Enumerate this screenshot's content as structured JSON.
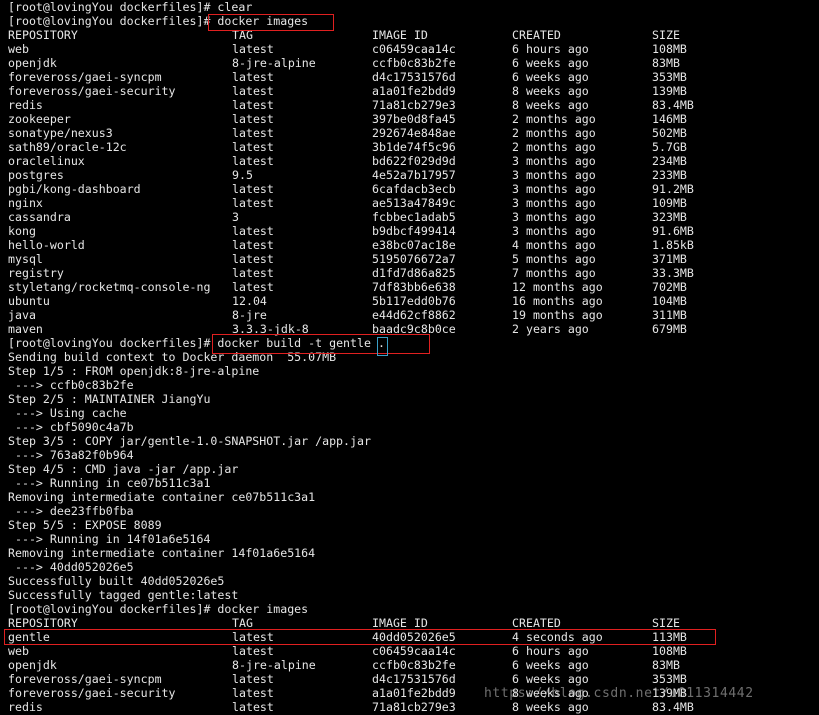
{
  "prompt": "[root@lovingYou dockerfiles]#",
  "commands": {
    "clear": "clear",
    "images1": "docker images",
    "build": "docker build -t gentle .",
    "images2": "docker images"
  },
  "table_header": {
    "repository": "REPOSITORY",
    "tag": "TAG",
    "image_id": "IMAGE ID",
    "created": "CREATED",
    "size": "SIZE"
  },
  "images_before": [
    {
      "repo": "web",
      "tag": "latest",
      "id": "c06459caa14c",
      "created": "6 hours ago",
      "size": "108MB"
    },
    {
      "repo": "openjdk",
      "tag": "8-jre-alpine",
      "id": "ccfb0c83b2fe",
      "created": "6 weeks ago",
      "size": "83MB"
    },
    {
      "repo": "foreveross/gaei-syncpm",
      "tag": "latest",
      "id": "d4c17531576d",
      "created": "6 weeks ago",
      "size": "353MB"
    },
    {
      "repo": "foreveross/gaei-security",
      "tag": "latest",
      "id": "a1a01fe2bdd9",
      "created": "8 weeks ago",
      "size": "139MB"
    },
    {
      "repo": "redis",
      "tag": "latest",
      "id": "71a81cb279e3",
      "created": "8 weeks ago",
      "size": "83.4MB"
    },
    {
      "repo": "zookeeper",
      "tag": "latest",
      "id": "397be0d8fa45",
      "created": "2 months ago",
      "size": "146MB"
    },
    {
      "repo": "sonatype/nexus3",
      "tag": "latest",
      "id": "292674e848ae",
      "created": "2 months ago",
      "size": "502MB"
    },
    {
      "repo": "sath89/oracle-12c",
      "tag": "latest",
      "id": "3b1de74f5c96",
      "created": "2 months ago",
      "size": "5.7GB"
    },
    {
      "repo": "oraclelinux",
      "tag": "latest",
      "id": "bd622f029d9d",
      "created": "3 months ago",
      "size": "234MB"
    },
    {
      "repo": "postgres",
      "tag": "9.5",
      "id": "4e52a7b17957",
      "created": "3 months ago",
      "size": "233MB"
    },
    {
      "repo": "pgbi/kong-dashboard",
      "tag": "latest",
      "id": "6cafdacb3ecb",
      "created": "3 months ago",
      "size": "91.2MB"
    },
    {
      "repo": "nginx",
      "tag": "latest",
      "id": "ae513a47849c",
      "created": "3 months ago",
      "size": "109MB"
    },
    {
      "repo": "cassandra",
      "tag": "3",
      "id": "fcbbec1adab5",
      "created": "3 months ago",
      "size": "323MB"
    },
    {
      "repo": "kong",
      "tag": "latest",
      "id": "b9dbcf499414",
      "created": "3 months ago",
      "size": "91.6MB"
    },
    {
      "repo": "hello-world",
      "tag": "latest",
      "id": "e38bc07ac18e",
      "created": "4 months ago",
      "size": "1.85kB"
    },
    {
      "repo": "mysql",
      "tag": "latest",
      "id": "5195076672a7",
      "created": "5 months ago",
      "size": "371MB"
    },
    {
      "repo": "registry",
      "tag": "latest",
      "id": "d1fd7d86a825",
      "created": "7 months ago",
      "size": "33.3MB"
    },
    {
      "repo": "styletang/rocketmq-console-ng",
      "tag": "latest",
      "id": "7df83bb6e638",
      "created": "12 months ago",
      "size": "702MB"
    },
    {
      "repo": "ubuntu",
      "tag": "12.04",
      "id": "5b117edd0b76",
      "created": "16 months ago",
      "size": "104MB"
    },
    {
      "repo": "java",
      "tag": "8-jre",
      "id": "e44d62cf8862",
      "created": "19 months ago",
      "size": "311MB"
    },
    {
      "repo": "maven",
      "tag": "3.3.3-jdk-8",
      "id": "baadc9c8b0ce",
      "created": "2 years ago",
      "size": "679MB"
    }
  ],
  "build_output": [
    "Sending build context to Docker daemon  55.07MB",
    "Step 1/5 : FROM openjdk:8-jre-alpine",
    " ---> ccfb0c83b2fe",
    "Step 2/5 : MAINTAINER JiangYu",
    " ---> Using cache",
    " ---> cbf5090c4a7b",
    "Step 3/5 : COPY jar/gentle-1.0-SNAPSHOT.jar /app.jar",
    " ---> 763a82f0b964",
    "Step 4/5 : CMD java -jar /app.jar",
    " ---> Running in ce07b511c3a1",
    "Removing intermediate container ce07b511c3a1",
    " ---> dee23ffb0fba",
    "Step 5/5 : EXPOSE 8089",
    " ---> Running in 14f01a6e5164",
    "Removing intermediate container 14f01a6e5164",
    " ---> 40dd052026e5",
    "Successfully built 40dd052026e5",
    "Successfully tagged gentle:latest"
  ],
  "images_after": [
    {
      "repo": "gentle",
      "tag": "latest",
      "id": "40dd052026e5",
      "created": "4 seconds ago",
      "size": "113MB"
    },
    {
      "repo": "web",
      "tag": "latest",
      "id": "c06459caa14c",
      "created": "6 hours ago",
      "size": "108MB"
    },
    {
      "repo": "openjdk",
      "tag": "8-jre-alpine",
      "id": "ccfb0c83b2fe",
      "created": "6 weeks ago",
      "size": "83MB"
    },
    {
      "repo": "foreveross/gaei-syncpm",
      "tag": "latest",
      "id": "d4c17531576d",
      "created": "6 weeks ago",
      "size": "353MB"
    },
    {
      "repo": "foreveross/gaei-security",
      "tag": "latest",
      "id": "a1a01fe2bdd9",
      "created": "8 weeks ago",
      "size": "139MB"
    },
    {
      "repo": "redis",
      "tag": "latest",
      "id": "71a81cb279e3",
      "created": "8 weeks ago",
      "size": "83.4MB"
    }
  ],
  "watermark": "https://blog.csdn.net/u011314442",
  "colors": {
    "background": "#000000",
    "text": "#e6e6e6",
    "highlight": "#e02020",
    "cursor": "#3aa0c8"
  }
}
